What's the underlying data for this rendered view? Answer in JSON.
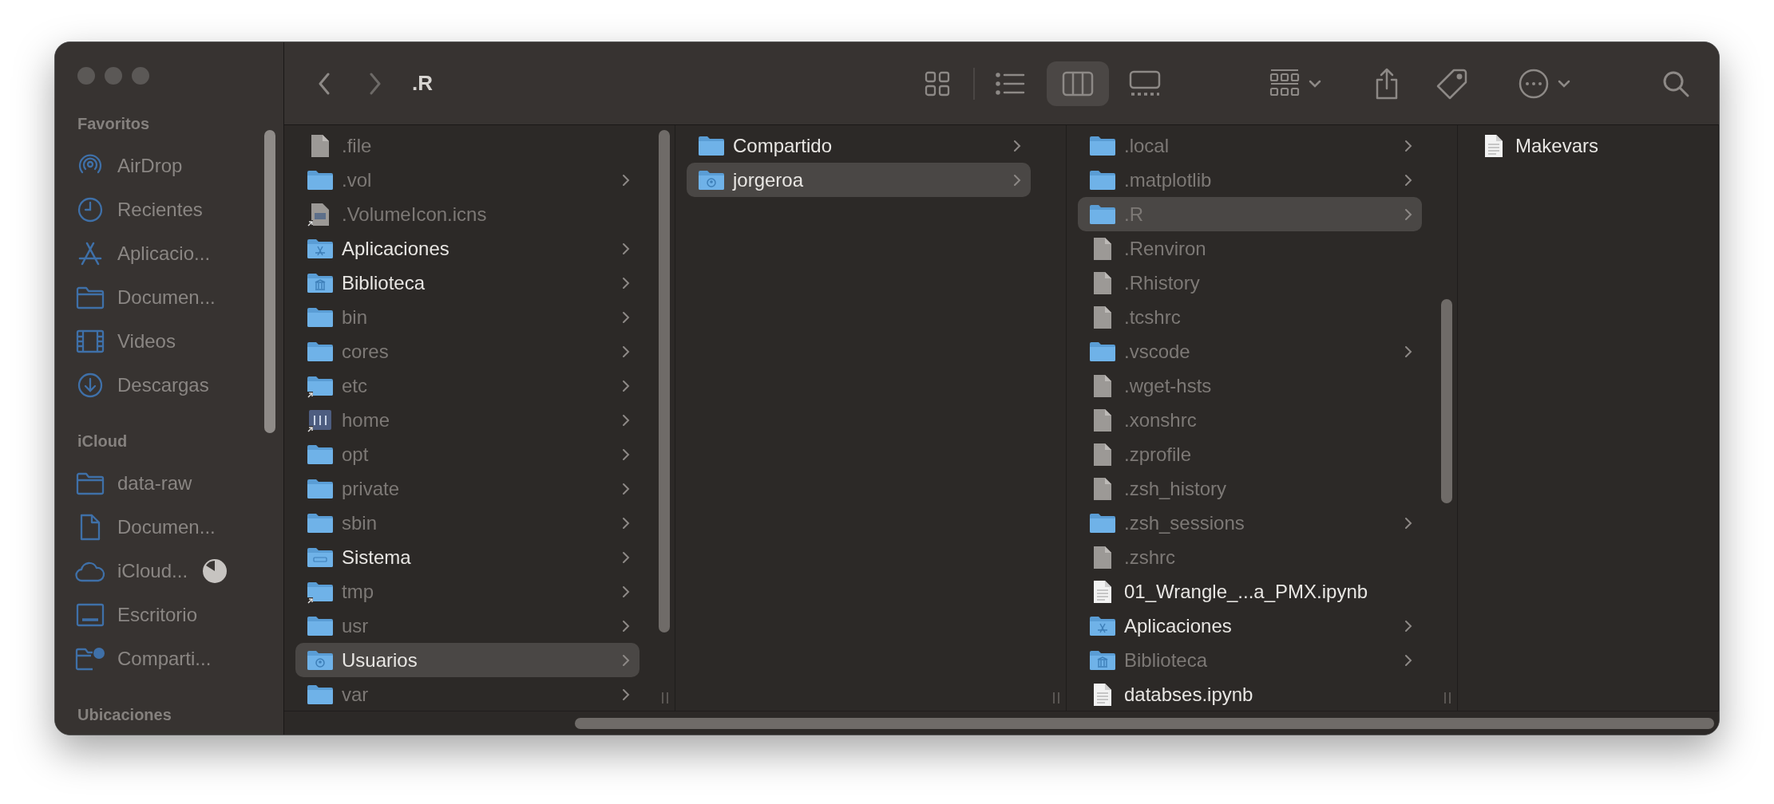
{
  "window": {
    "title": ".R"
  },
  "toolbar": {
    "views": [
      {
        "kind": "icons",
        "selected": false
      },
      {
        "kind": "list",
        "selected": false
      },
      {
        "kind": "columns",
        "selected": true
      },
      {
        "kind": "gallery",
        "selected": false
      }
    ]
  },
  "sidebar": {
    "sections": [
      {
        "title": "Favoritos",
        "items": [
          {
            "label": "AirDrop",
            "kind": "airdrop"
          },
          {
            "label": "Recientes",
            "kind": "clock"
          },
          {
            "label": "Aplicacio...",
            "kind": "apps"
          },
          {
            "label": "Documen...",
            "kind": "folder"
          },
          {
            "label": "Videos",
            "kind": "film"
          },
          {
            "label": "Descargas",
            "kind": "download"
          }
        ]
      },
      {
        "title": "iCloud",
        "items": [
          {
            "label": "data-raw",
            "kind": "folder"
          },
          {
            "label": "Documen...",
            "kind": "doc"
          },
          {
            "label": "iCloud...",
            "kind": "cloud",
            "progress": true
          },
          {
            "label": "Escritorio",
            "kind": "desktop"
          },
          {
            "label": "Comparti...",
            "kind": "shared"
          }
        ]
      },
      {
        "title": "Ubicaciones"
      }
    ]
  },
  "columns": [
    {
      "items": [
        {
          "name": ".file",
          "kind": "file",
          "dimmed": true,
          "alias": false,
          "has_children": false,
          "selected": false
        },
        {
          "name": ".vol",
          "kind": "folder",
          "dimmed": true,
          "alias": false,
          "has_children": true,
          "selected": false
        },
        {
          "name": ".VolumeIcon.icns",
          "kind": "image",
          "dimmed": true,
          "alias": true,
          "has_children": false,
          "selected": false
        },
        {
          "name": "Aplicaciones",
          "kind": "folder-apps",
          "dimmed": false,
          "alias": false,
          "has_children": true,
          "selected": false
        },
        {
          "name": "Biblioteca",
          "kind": "folder-library",
          "dimmed": false,
          "alias": false,
          "has_children": true,
          "selected": false
        },
        {
          "name": "bin",
          "kind": "folder",
          "dimmed": true,
          "alias": false,
          "has_children": true,
          "selected": false
        },
        {
          "name": "cores",
          "kind": "folder",
          "dimmed": true,
          "alias": false,
          "has_children": true,
          "selected": false
        },
        {
          "name": "etc",
          "kind": "folder",
          "dimmed": true,
          "alias": true,
          "has_children": true,
          "selected": false
        },
        {
          "name": "home",
          "kind": "drive",
          "dimmed": true,
          "alias": true,
          "has_children": true,
          "selected": false
        },
        {
          "name": "opt",
          "kind": "folder",
          "dimmed": true,
          "alias": false,
          "has_children": true,
          "selected": false
        },
        {
          "name": "private",
          "kind": "folder",
          "dimmed": true,
          "alias": false,
          "has_children": true,
          "selected": false
        },
        {
          "name": "sbin",
          "kind": "folder",
          "dimmed": true,
          "alias": false,
          "has_children": true,
          "selected": false
        },
        {
          "name": "Sistema",
          "kind": "folder-system",
          "dimmed": false,
          "alias": false,
          "has_children": true,
          "selected": false
        },
        {
          "name": "tmp",
          "kind": "folder",
          "dimmed": true,
          "alias": true,
          "has_children": true,
          "selected": false
        },
        {
          "name": "usr",
          "kind": "folder",
          "dimmed": true,
          "alias": false,
          "has_children": true,
          "selected": false
        },
        {
          "name": "Usuarios",
          "kind": "folder-user",
          "dimmed": false,
          "alias": false,
          "has_children": true,
          "selected": true
        },
        {
          "name": "var",
          "kind": "folder",
          "dimmed": true,
          "alias": false,
          "has_children": true,
          "selected": false
        }
      ]
    },
    {
      "items": [
        {
          "name": "Compartido",
          "kind": "folder",
          "dimmed": false,
          "alias": false,
          "has_children": true,
          "selected": false
        },
        {
          "name": "jorgeroa",
          "kind": "folder-user",
          "dimmed": false,
          "alias": false,
          "has_children": true,
          "selected": true
        }
      ]
    },
    {
      "items": [
        {
          "name": ".local",
          "kind": "folder",
          "dimmed": true,
          "alias": false,
          "has_children": true,
          "selected": false
        },
        {
          "name": ".matplotlib",
          "kind": "folder",
          "dimmed": true,
          "alias": false,
          "has_children": true,
          "selected": false
        },
        {
          "name": ".R",
          "kind": "folder",
          "dimmed": true,
          "alias": false,
          "has_children": true,
          "selected": true
        },
        {
          "name": ".Renviron",
          "kind": "file",
          "dimmed": true,
          "alias": false,
          "has_children": false,
          "selected": false
        },
        {
          "name": ".Rhistory",
          "kind": "file",
          "dimmed": true,
          "alias": false,
          "has_children": false,
          "selected": false
        },
        {
          "name": ".tcshrc",
          "kind": "file",
          "dimmed": true,
          "alias": false,
          "has_children": false,
          "selected": false
        },
        {
          "name": ".vscode",
          "kind": "folder",
          "dimmed": true,
          "alias": false,
          "has_children": true,
          "selected": false
        },
        {
          "name": ".wget-hsts",
          "kind": "file",
          "dimmed": true,
          "alias": false,
          "has_children": false,
          "selected": false
        },
        {
          "name": ".xonshrc",
          "kind": "file",
          "dimmed": true,
          "alias": false,
          "has_children": false,
          "selected": false
        },
        {
          "name": ".zprofile",
          "kind": "file",
          "dimmed": true,
          "alias": false,
          "has_children": false,
          "selected": false
        },
        {
          "name": ".zsh_history",
          "kind": "file",
          "dimmed": true,
          "alias": false,
          "has_children": false,
          "selected": false
        },
        {
          "name": ".zsh_sessions",
          "kind": "folder",
          "dimmed": true,
          "alias": false,
          "has_children": true,
          "selected": false
        },
        {
          "name": ".zshrc",
          "kind": "file",
          "dimmed": true,
          "alias": false,
          "has_children": false,
          "selected": false
        },
        {
          "name": "01_Wrangle_...a_PMX.ipynb",
          "kind": "document",
          "dimmed": false,
          "alias": false,
          "has_children": false,
          "selected": false
        },
        {
          "name": "Aplicaciones",
          "kind": "folder-apps",
          "dimmed": false,
          "alias": false,
          "has_children": true,
          "selected": false
        },
        {
          "name": "Biblioteca",
          "kind": "folder-library",
          "dimmed": true,
          "alias": false,
          "has_children": true,
          "selected": false
        },
        {
          "name": "databses.ipynb",
          "kind": "document",
          "dimmed": false,
          "alias": false,
          "has_children": false,
          "selected": false
        }
      ]
    },
    {
      "items": [
        {
          "name": "Makevars",
          "kind": "document",
          "dimmed": false,
          "alias": false,
          "has_children": false,
          "selected": false
        }
      ]
    }
  ]
}
